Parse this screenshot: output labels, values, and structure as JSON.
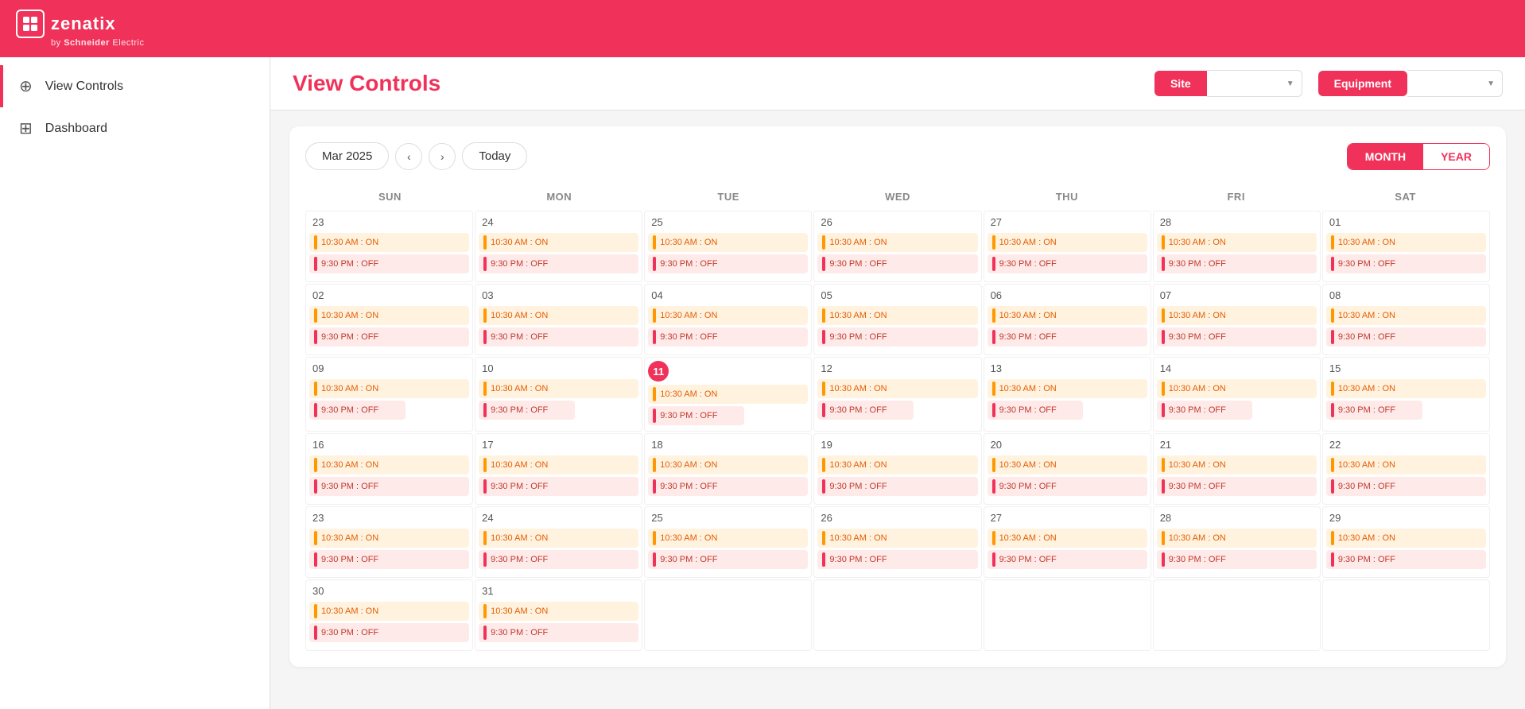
{
  "header": {
    "logo_text": "zenatix",
    "logo_sub_prefix": "by ",
    "logo_sub_brand": "Schneider",
    "logo_sub_suffix": " Electric"
  },
  "sidebar": {
    "items": [
      {
        "id": "view-controls",
        "label": "View Controls",
        "icon": "⊕",
        "active": true
      },
      {
        "id": "dashboard",
        "label": "Dashboard",
        "icon": "⊞",
        "active": false
      }
    ]
  },
  "topbar": {
    "page_title": "View Controls",
    "site_btn": "Site",
    "site_dropdown_placeholder": "",
    "equipment_btn": "Equipment",
    "equipment_dropdown_placeholder": ""
  },
  "calendar": {
    "month_label": "Mar 2025",
    "today_btn": "Today",
    "view_month": "MONTH",
    "view_year": "YEAR",
    "day_names": [
      "SUN",
      "MON",
      "TUE",
      "WED",
      "THU",
      "FRI",
      "SAT"
    ],
    "today_date": 11,
    "on_event": "10:30 AM : ON",
    "off_event": "9:30 PM : OFF",
    "weeks": [
      {
        "days": [
          {
            "date": "23",
            "events": [
              "on",
              "off"
            ]
          },
          {
            "date": "24",
            "events": [
              "on",
              "off"
            ]
          },
          {
            "date": "25",
            "events": [
              "on",
              "off"
            ]
          },
          {
            "date": "26",
            "events": [
              "on",
              "off"
            ]
          },
          {
            "date": "27",
            "events": [
              "on",
              "off"
            ]
          },
          {
            "date": "28",
            "events": [
              "on",
              "off"
            ]
          },
          {
            "date": "01",
            "events": [
              "on",
              "off"
            ]
          }
        ]
      },
      {
        "days": [
          {
            "date": "02",
            "events": [
              "on",
              "off"
            ]
          },
          {
            "date": "03",
            "events": [
              "on",
              "off"
            ]
          },
          {
            "date": "04",
            "events": [
              "on",
              "off"
            ]
          },
          {
            "date": "05",
            "events": [
              "on",
              "off"
            ]
          },
          {
            "date": "06",
            "events": [
              "on",
              "off"
            ]
          },
          {
            "date": "07",
            "events": [
              "on",
              "off"
            ]
          },
          {
            "date": "08",
            "events": [
              "on",
              "off"
            ]
          }
        ]
      },
      {
        "days": [
          {
            "date": "09",
            "events": [
              "on",
              "off_partial"
            ]
          },
          {
            "date": "10",
            "events": [
              "on",
              "off_partial"
            ]
          },
          {
            "date": "11",
            "events": [
              "on",
              "off_partial"
            ],
            "today": true
          },
          {
            "date": "12",
            "events": [
              "on",
              "off_partial"
            ]
          },
          {
            "date": "13",
            "events": [
              "on",
              "off_partial"
            ]
          },
          {
            "date": "14",
            "events": [
              "on",
              "off_partial"
            ]
          },
          {
            "date": "15",
            "events": [
              "on",
              "off_partial"
            ]
          }
        ]
      },
      {
        "days": [
          {
            "date": "16",
            "events": [
              "on",
              "off"
            ]
          },
          {
            "date": "17",
            "events": [
              "on",
              "off"
            ]
          },
          {
            "date": "18",
            "events": [
              "on",
              "off"
            ]
          },
          {
            "date": "19",
            "events": [
              "on",
              "off"
            ]
          },
          {
            "date": "20",
            "events": [
              "on",
              "off"
            ]
          },
          {
            "date": "21",
            "events": [
              "on",
              "off"
            ]
          },
          {
            "date": "22",
            "events": [
              "on",
              "off"
            ]
          }
        ]
      },
      {
        "days": [
          {
            "date": "23",
            "events": [
              "on",
              "off"
            ]
          },
          {
            "date": "24",
            "events": [
              "on",
              "off"
            ]
          },
          {
            "date": "25",
            "events": [
              "on",
              "off"
            ]
          },
          {
            "date": "26",
            "events": [
              "on",
              "off"
            ]
          },
          {
            "date": "27",
            "events": [
              "on",
              "off"
            ]
          },
          {
            "date": "28",
            "events": [
              "on",
              "off"
            ]
          },
          {
            "date": "29",
            "events": [
              "on",
              "off"
            ]
          }
        ]
      },
      {
        "days": [
          {
            "date": "30",
            "events": [
              "on",
              "off"
            ]
          },
          {
            "date": "31",
            "events": [
              "on",
              "off"
            ]
          },
          {
            "date": "",
            "events": []
          },
          {
            "date": "",
            "events": []
          },
          {
            "date": "",
            "events": []
          },
          {
            "date": "",
            "events": []
          },
          {
            "date": "",
            "events": []
          }
        ]
      }
    ]
  }
}
